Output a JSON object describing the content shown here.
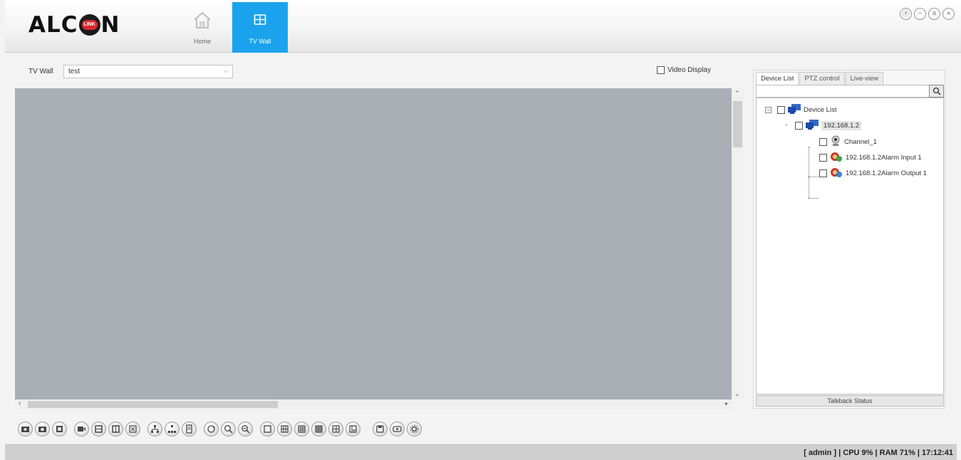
{
  "app": {
    "logo_prefix": "ALC",
    "logo_badge": "LINK",
    "logo_suffix": "N",
    "brand_color": "#d9272e",
    "accent_color": "#1aa3ec"
  },
  "nav": {
    "home": {
      "label": "Home",
      "icon": "home-icon"
    },
    "tvwall": {
      "label": "TV Wall",
      "icon": "grid-icon"
    }
  },
  "window_controls": [
    "lock-icon",
    "minimize-icon",
    "restore-icon",
    "close-icon"
  ],
  "tvwall_bar": {
    "label": "TV Wall",
    "selected": "test",
    "video_display_label": "Video Display",
    "video_display_checked": false
  },
  "right_panel": {
    "tabs": [
      "Device List",
      "PTZ control",
      "Live-view"
    ],
    "active_tab": "Device List",
    "tree": {
      "root_label": "Device List",
      "device_label": "192.168.1.2",
      "children": [
        "Channel_1",
        "192.168.1.2Alarm Input 1",
        "192.168.1.2Alarm Output 1"
      ]
    },
    "talkback_label": "Talkback Status"
  },
  "toolbar": {
    "icons": [
      "snapshot-icon",
      "camera-icon",
      "record-icon",
      "video-icon",
      "multi-snapshot-icon",
      "split-icon",
      "fullscreen-icon",
      "tree-icon",
      "network-icon",
      "document-icon",
      "rotate-icon",
      "zoom-in-icon",
      "zoom-out-icon",
      "layout-1-icon",
      "layout-4-icon",
      "layout-9-icon",
      "layout-16-icon",
      "layout-6-icon",
      "layout-8-icon",
      "save-icon",
      "refresh-icon",
      "settings-icon"
    ]
  },
  "status": {
    "text": "[ admin ] | CPU  9% | RAM  71% | 17:12:41"
  }
}
